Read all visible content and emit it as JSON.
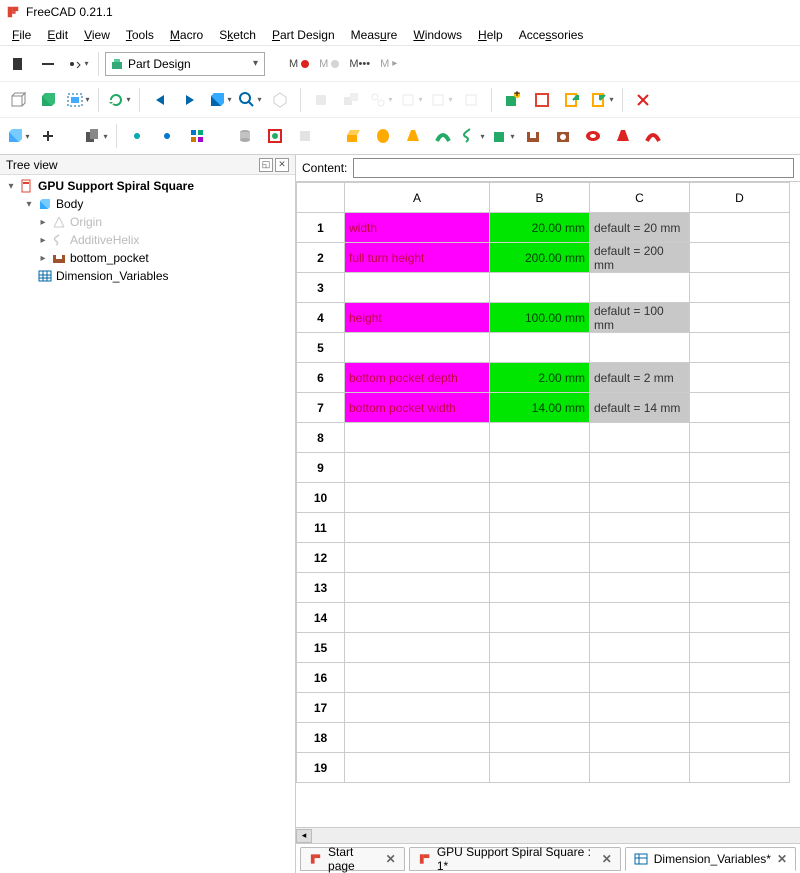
{
  "title": "FreeCAD 0.21.1",
  "menus": [
    "File",
    "Edit",
    "View",
    "Tools",
    "Macro",
    "Sketch",
    "Part Design",
    "Measure",
    "Windows",
    "Help",
    "Accessories"
  ],
  "workbench": {
    "label": "Part Design"
  },
  "macro_labels": [
    "M",
    "M",
    "M•••",
    "M"
  ],
  "tree": {
    "title": "Tree view",
    "root": "GPU Support Spiral Square",
    "body": "Body",
    "origin": "Origin",
    "helix": "AdditiveHelix",
    "bottom_pocket": "bottom_pocket",
    "dim_vars": "Dimension_Variables"
  },
  "content_label": "Content:",
  "content_value": "",
  "columns": [
    "A",
    "B",
    "C",
    "D"
  ],
  "row_numbers": [
    "1",
    "2",
    "3",
    "4",
    "5",
    "6",
    "7",
    "8",
    "9",
    "10",
    "11",
    "12",
    "13",
    "14",
    "15",
    "16",
    "17",
    "18",
    "19"
  ],
  "cells": {
    "r1": {
      "a": "width",
      "b": "20.00 mm",
      "c": "default = 20 mm"
    },
    "r2": {
      "a": "full  turn height",
      "b": "200.00 mm",
      "c": "default = 200 mm"
    },
    "r4": {
      "a": "height",
      "b": "100.00 mm",
      "c": "defalut = 100 mm"
    },
    "r6": {
      "a": "bottom pocket depth",
      "b": "2.00 mm",
      "c": "default = 2 mm"
    },
    "r7": {
      "a": "bottom pocket width",
      "b": "14.00 mm",
      "c": "default = 14 mm"
    }
  },
  "tabs": [
    {
      "label": "Start page"
    },
    {
      "label": "GPU Support Spiral Square : 1*"
    },
    {
      "label": "Dimension_Variables*"
    }
  ]
}
